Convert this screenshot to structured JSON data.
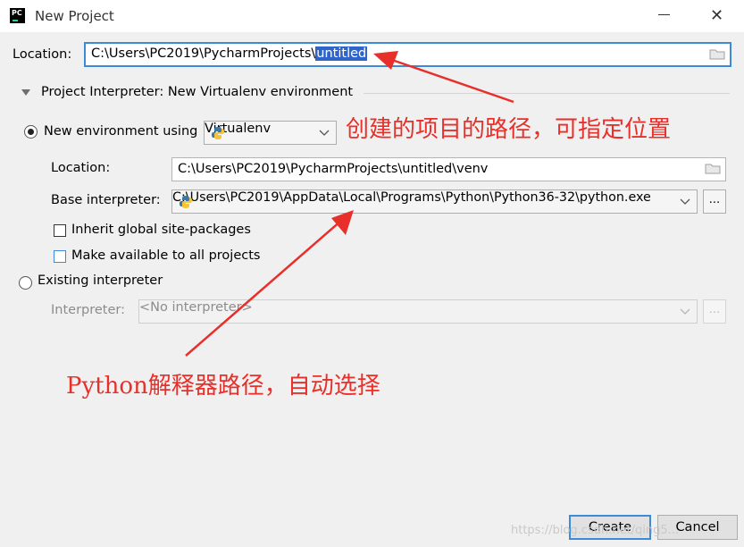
{
  "window": {
    "title": "New Project",
    "app_icon_text": "PC",
    "close_glyph": "✕"
  },
  "location": {
    "label": "Location:",
    "path_prefix": "C:\\Users\\PC2019\\PycharmProjects\\",
    "path_selected": "untitled"
  },
  "interpreter_section": {
    "title": "Project Interpreter: New Virtualenv environment",
    "new_env_radio_label": "New environment using",
    "env_tool_value": "Virtualenv",
    "venv_location_label": "Location:",
    "venv_location_value": "C:\\Users\\PC2019\\PycharmProjects\\untitled\\venv",
    "base_interpreter_label": "Base interpreter:",
    "base_interpreter_value": "C:\\Users\\PC2019\\AppData\\Local\\Programs\\Python\\Python36-32\\python.exe",
    "browse_label": "...",
    "inherit_label": "Inherit global site-packages",
    "make_available_label": "Make available to all projects",
    "existing_radio_label": "Existing interpreter",
    "interpreter_label": "Interpreter:",
    "interpreter_value": "<No interpreter>"
  },
  "annotations": {
    "top": "创建的项目的路径，可指定位置",
    "bottom": "Python解释器路径，自动选择"
  },
  "buttons": {
    "create": "Create",
    "cancel": "Cancel"
  },
  "watermark": "https://blog.csdn.net/qing5..."
}
